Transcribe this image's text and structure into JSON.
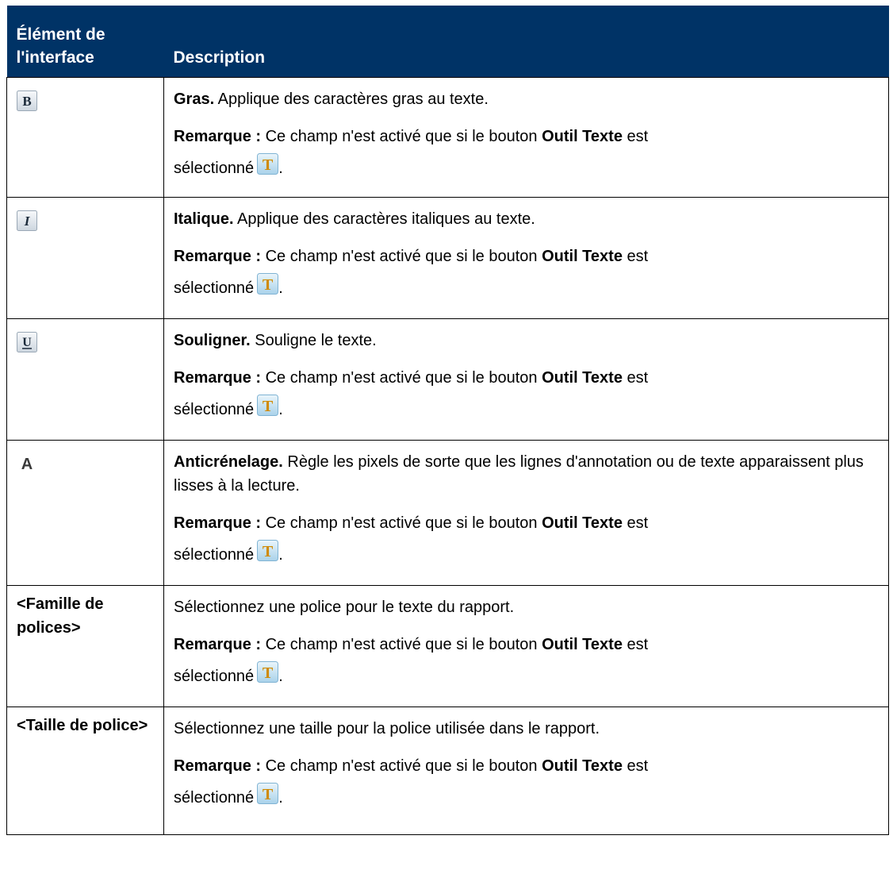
{
  "table": {
    "header": {
      "col1": "Élément de l'interface",
      "col2": "Description"
    },
    "note_label": "Remarque :",
    "note_text_1": "Ce champ n'est activé que si le bouton",
    "note_tool": "Outil Texte",
    "note_text_2": "est",
    "note_text_3": "sélectionné",
    "note_end": ".",
    "rows": [
      {
        "icon": "bold-icon",
        "title": "Gras.",
        "desc": "Applique des caractères gras au texte."
      },
      {
        "icon": "italic-icon",
        "title": "Italique.",
        "desc": "Applique des caractères italiques au texte."
      },
      {
        "icon": "underline-icon",
        "title": "Souligner.",
        "desc": "Souligne le texte."
      },
      {
        "icon": "antialias-icon",
        "title": "Anticrénelage.",
        "desc": "Règle les pixels de sorte que les lignes d'annotation ou de texte apparaissent plus lisses à la lecture."
      },
      {
        "name": "<Famille de polices>",
        "desc": "Sélectionnez une police pour le texte du rapport."
      },
      {
        "name": "<Taille de police>",
        "desc": "Sélectionnez une taille pour la police utilisée dans le rapport."
      }
    ]
  },
  "icons": {
    "text_tool": "text-tool-icon"
  },
  "colors": {
    "header_bg": "#003366",
    "header_text": "#ffffff",
    "text_tool_glyph": "#d08a00"
  }
}
